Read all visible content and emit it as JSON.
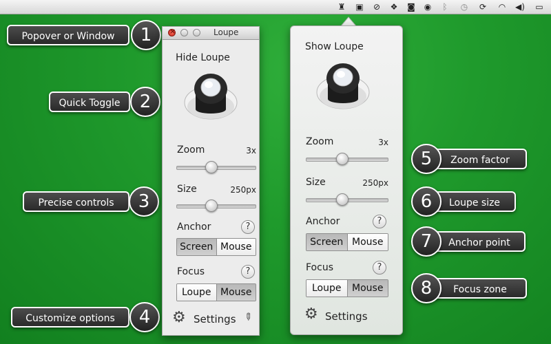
{
  "menubar": {
    "icons": [
      "loupe-icon",
      "display-icon",
      "block-icon",
      "dropbox-icon",
      "chat-icon",
      "circle-icon",
      "bluetooth-icon",
      "time-machine-icon",
      "sync-icon",
      "wifi-icon",
      "volume-icon",
      "battery-icon"
    ]
  },
  "callouts": [
    {
      "num": "1",
      "label": "Popover or Window"
    },
    {
      "num": "2",
      "label": "Quick Toggle"
    },
    {
      "num": "3",
      "label": "Precise controls"
    },
    {
      "num": "4",
      "label": "Customize options"
    },
    {
      "num": "5",
      "label": "Zoom factor"
    },
    {
      "num": "6",
      "label": "Loupe size"
    },
    {
      "num": "7",
      "label": "Anchor point"
    },
    {
      "num": "8",
      "label": "Focus zone"
    }
  ],
  "window": {
    "title": "Loupe",
    "toggle_label": "Hide Loupe",
    "zoom_label": "Zoom",
    "zoom_value": "3x",
    "zoom_fraction": 0.45,
    "size_label": "Size",
    "size_value": "250px",
    "size_fraction": 0.45,
    "anchor_label": "Anchor",
    "anchor_options": [
      "Screen",
      "Mouse"
    ],
    "anchor_selected": 0,
    "focus_label": "Focus",
    "focus_options": [
      "Loupe",
      "Mouse"
    ],
    "focus_selected": 1,
    "help": "?",
    "settings_label": "Settings"
  },
  "popover": {
    "toggle_label": "Show Loupe",
    "zoom_label": "Zoom",
    "zoom_value": "3x",
    "zoom_fraction": 0.45,
    "size_label": "Size",
    "size_value": "250px",
    "size_fraction": 0.45,
    "anchor_label": "Anchor",
    "anchor_options": [
      "Screen",
      "Mouse"
    ],
    "anchor_selected": 0,
    "focus_label": "Focus",
    "focus_options": [
      "Loupe",
      "Mouse"
    ],
    "focus_selected": 1,
    "help": "?",
    "settings_label": "Settings"
  }
}
